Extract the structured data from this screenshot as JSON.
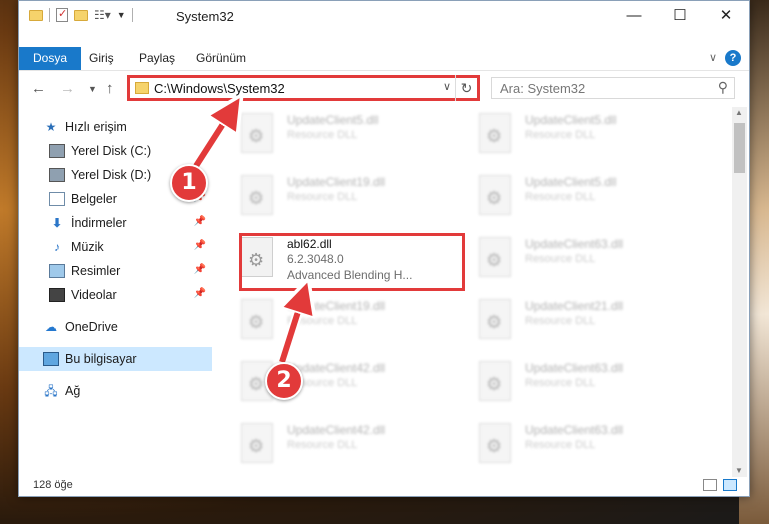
{
  "window": {
    "title": "System32",
    "controls": {
      "minimize": "—",
      "maximize": "☐",
      "close": "✕"
    }
  },
  "ribbon": {
    "tabs": [
      "Dosya",
      "Giriş",
      "Paylaş",
      "Görünüm"
    ],
    "help": "?"
  },
  "nav": {
    "address": "C:\\Windows\\System32",
    "search_placeholder": "Ara: System32"
  },
  "sidebar": {
    "items": [
      {
        "label": "Hızlı erişim",
        "icon": "star-icon"
      },
      {
        "label": "Yerel Disk (C:)",
        "icon": "drive-icon"
      },
      {
        "label": "Yerel Disk (D:)",
        "icon": "drive-icon"
      },
      {
        "label": "Belgeler",
        "icon": "documents-icon",
        "pinned": true
      },
      {
        "label": "İndirmeler",
        "icon": "downloads-icon",
        "pinned": true
      },
      {
        "label": "Müzik",
        "icon": "music-icon",
        "pinned": true
      },
      {
        "label": "Resimler",
        "icon": "pictures-icon",
        "pinned": true
      },
      {
        "label": "Videolar",
        "icon": "videos-icon",
        "pinned": true
      },
      {
        "label": "OneDrive",
        "icon": "onedrive-icon"
      },
      {
        "label": "Bu bilgisayar",
        "icon": "this-pc-icon",
        "selected": true
      },
      {
        "label": "Ağ",
        "icon": "network-icon"
      }
    ]
  },
  "files": {
    "col1": [
      {
        "name": "UpdateClient5.dll",
        "desc": "Resource DLL"
      },
      {
        "name": "UpdateClient19.dll",
        "desc": "Resource DLL"
      },
      {
        "name": "abl62.dll",
        "version": "6.2.3048.0",
        "desc": "Advanced Blending H..."
      },
      {
        "name": "UpdateClient19.dll",
        "desc": "Resource DLL"
      },
      {
        "name": "UpdateClient42.dll",
        "desc": "Resource DLL"
      },
      {
        "name": "UpdateClient42.dll",
        "desc": "Resource DLL"
      }
    ],
    "col2": [
      {
        "name": "UpdateClient5.dll",
        "desc": "Resource DLL"
      },
      {
        "name": "UpdateClient5.dll",
        "desc": "Resource DLL"
      },
      {
        "name": "UpdateClient63.dll",
        "desc": "Resource DLL"
      },
      {
        "name": "UpdateClient21.dll",
        "desc": "Resource DLL"
      },
      {
        "name": "UpdateClient63.dll",
        "desc": "Resource DLL"
      },
      {
        "name": "UpdateClient63.dll",
        "desc": "Resource DLL"
      }
    ]
  },
  "status": {
    "count": "128 öğe"
  },
  "callouts": {
    "one": "1",
    "two": "2"
  },
  "colors": {
    "accent": "#1979ca",
    "highlight": "#e23a3a",
    "selected": "#cce8ff"
  }
}
